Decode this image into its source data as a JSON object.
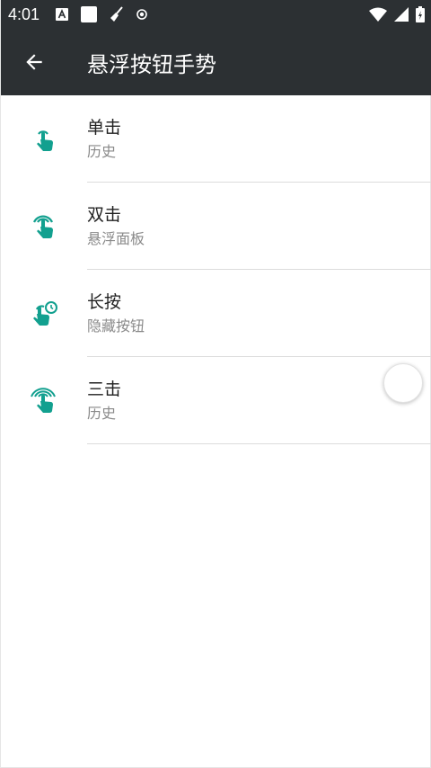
{
  "status_bar": {
    "time": "4:01",
    "left_icons": [
      "font-a-icon",
      "white-square-icon",
      "broom-icon",
      "record-icon"
    ],
    "right_icons": [
      "wifi-icon",
      "signal-icon",
      "battery-charging-icon"
    ]
  },
  "app_bar": {
    "title": "悬浮按钮手势",
    "back_icon": "arrow-back-icon"
  },
  "items": [
    {
      "title": "单击",
      "subtitle": "历史",
      "icon": "single-tap-icon"
    },
    {
      "title": "双击",
      "subtitle": "悬浮面板",
      "icon": "double-tap-icon"
    },
    {
      "title": "长按",
      "subtitle": "隐藏按钮",
      "icon": "long-press-icon"
    },
    {
      "title": "三击",
      "subtitle": "历史",
      "icon": "triple-tap-icon"
    }
  ],
  "colors": {
    "app_bar": "#2c3033",
    "icon_teal": "#12a08f",
    "title_text": "#212121",
    "subtitle_text": "#8a8a8a",
    "divider": "#dcdcdc"
  }
}
